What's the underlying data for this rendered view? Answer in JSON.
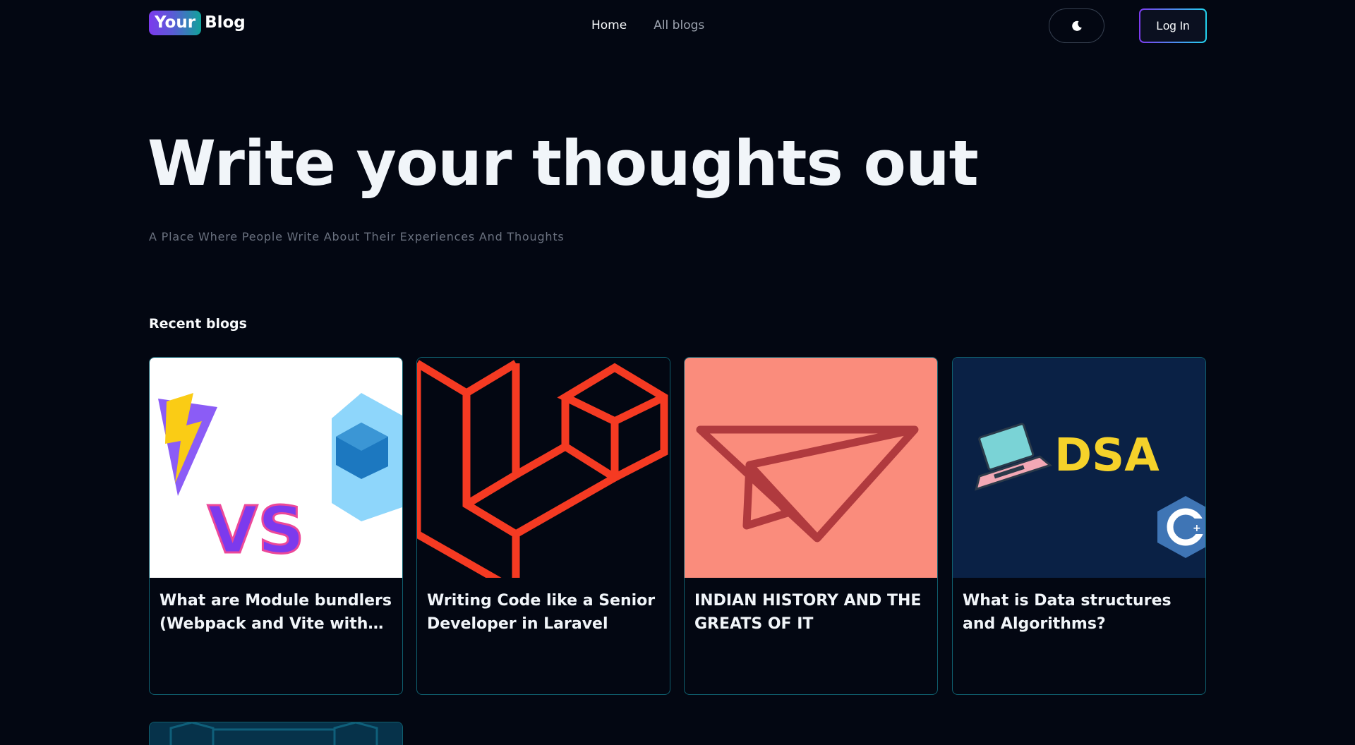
{
  "header": {
    "logo_badge": "Your",
    "logo_text": "Blog",
    "nav": [
      {
        "label": "Home",
        "active": true
      },
      {
        "label": "All blogs",
        "active": false
      }
    ],
    "theme_icon": "moon-icon",
    "login_label": "Log In"
  },
  "hero": {
    "title": "Write your thoughts out",
    "subtitle": "A Place Where People Write About Their Experiences And Thoughts"
  },
  "recent": {
    "heading": "Recent blogs",
    "cards": [
      {
        "title": "What are Module bundlers (Webpack and Vite with babl...",
        "image": "vite-vs-webpack-thumbnail"
      },
      {
        "title": "Writing Code like a Senior Developer in Laravel",
        "image": "laravel-logo-thumbnail"
      },
      {
        "title": "INDIAN HISTORY AND THE GREATS OF IT",
        "image": "paper-plane-thumbnail"
      },
      {
        "title": "What is Data structures and Algorithms?",
        "image": "dsa-thumbnail",
        "image_text": "DSA"
      }
    ]
  },
  "colors": {
    "background": "#030712",
    "card_border": "#0f5f6e",
    "accent_purple": "#7c3aed",
    "accent_teal": "#10a39a"
  }
}
